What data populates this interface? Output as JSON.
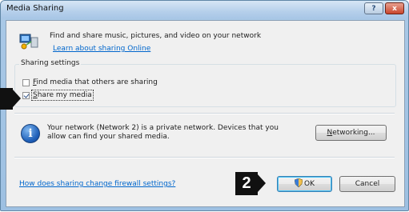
{
  "window": {
    "title": "Media Sharing",
    "help_glyph": "?",
    "close_glyph": "x"
  },
  "intro": {
    "text": "Find and share music, pictures, and video on your network",
    "learn_link": "Learn about sharing Online",
    "icon": "media-network-icon"
  },
  "sharing_settings": {
    "label": "Sharing settings",
    "options": [
      {
        "accel": "F",
        "rest": "ind media that others are sharing",
        "checked": false
      },
      {
        "accel": "S",
        "rest": "hare my media",
        "checked": true
      }
    ]
  },
  "network_info": {
    "icon": "info-icon",
    "icon_glyph": "i",
    "text": "Your network (Network  2) is a private network. Devices that you allow can find your shared media.",
    "networking_button": {
      "accel": "N",
      "rest": "etworking..."
    }
  },
  "footer": {
    "firewall_link": "How does sharing change firewall settings?",
    "ok_label": "OK",
    "cancel_label": "Cancel"
  },
  "callouts": {
    "second": "2"
  },
  "colors": {
    "link": "#0066cc",
    "callout_bg": "#111111",
    "frame": "#a9c8e6"
  }
}
